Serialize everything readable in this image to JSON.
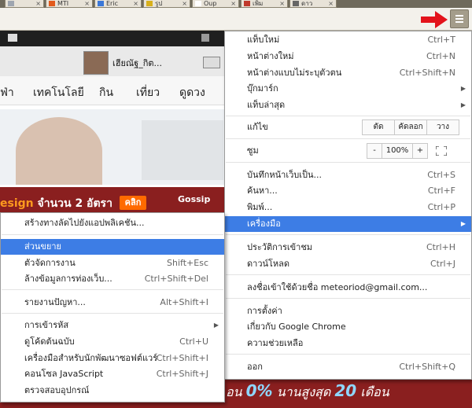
{
  "browser": {
    "tabs": [
      {
        "title": "MTI",
        "favicon_color": "#e25a1c"
      },
      {
        "title": "Eric",
        "favicon_color": "#3b78d8"
      },
      {
        "title": "รูป",
        "favicon_color": "#d8b01c"
      },
      {
        "title": "Oup",
        "favicon_color": "#ffffff"
      },
      {
        "title": "เพิ่ม",
        "favicon_color": "#c0392b"
      },
      {
        "title": "ดาว",
        "favicon_color": "#666666"
      }
    ],
    "tab_close": "×",
    "accent_color": "#3d7de5"
  },
  "page": {
    "username": "เฮียณัฐ_กิต...",
    "nav_items": [
      "ฟ่า",
      "เทคโนโลยี",
      "กิน",
      "เที่ยว",
      "ดูดวง"
    ],
    "promo_highlight": "esign",
    "promo_text": " จำนวน 2 อัตรา",
    "click_label": "คลิก",
    "gossip_label": "Gossip",
    "banner_pre": "อน ",
    "banner_pct": "0%",
    "banner_mid": " นานสูงสุด ",
    "banner_num": "20",
    "banner_post": " เดือน"
  },
  "menu": {
    "new_tab": {
      "label": "แท็บใหม่",
      "shortcut": "Ctrl+T"
    },
    "new_window": {
      "label": "หน้าต่างใหม่",
      "shortcut": "Ctrl+N"
    },
    "incognito": {
      "label": "หน้าต่างแบบไม่ระบุตัวตน",
      "shortcut": "Ctrl+Shift+N"
    },
    "bookmarks": {
      "label": "บุ๊กมาร์ก"
    },
    "recent_tabs": {
      "label": "แท็บล่าสุด"
    },
    "edit": {
      "label": "แก้ไข",
      "cut": "ตัด",
      "copy": "คัดลอก",
      "paste": "วาง"
    },
    "zoom": {
      "label": "ซูม",
      "minus": "-",
      "value": "100%",
      "plus": "+"
    },
    "save_page": {
      "label": "บันทึกหน้าเว็บเป็น...",
      "shortcut": "Ctrl+S"
    },
    "find": {
      "label": "ค้นหา...",
      "shortcut": "Ctrl+F"
    },
    "print": {
      "label": "พิมพ์...",
      "shortcut": "Ctrl+P"
    },
    "tools": {
      "label": "เครื่องมือ"
    },
    "history": {
      "label": "ประวัติการเข้าชม",
      "shortcut": "Ctrl+H"
    },
    "downloads": {
      "label": "ดาวน์โหลด",
      "shortcut": "Ctrl+J"
    },
    "signed_in": {
      "label": "ลงชื่อเข้าใช้ด้วยชื่อ meteoriod@gmail.com..."
    },
    "settings": {
      "label": "การตั้งค่า"
    },
    "about": {
      "label": "เกี่ยวกับ Google Chrome"
    },
    "help": {
      "label": "ความช่วยเหลือ"
    },
    "exit": {
      "label": "ออก",
      "shortcut": "Ctrl+Shift+Q"
    }
  },
  "submenu": {
    "create_shortcut": {
      "label": "สร้างทางลัดไปยังแอปพลิเคชัน..."
    },
    "extensions": {
      "label": "ส่วนขยาย"
    },
    "task_manager": {
      "label": "ตัวจัดการงาน",
      "shortcut": "Shift+Esc"
    },
    "clear_data": {
      "label": "ล้างข้อมูลการท่องเว็บ...",
      "shortcut": "Ctrl+Shift+Del"
    },
    "report_issue": {
      "label": "รายงานปัญหา...",
      "shortcut": "Alt+Shift+I"
    },
    "encoding": {
      "label": "การเข้ารหัส"
    },
    "view_source": {
      "label": "ดูโค้ดต้นฉบับ",
      "shortcut": "Ctrl+U"
    },
    "dev_tools": {
      "label": "เครื่องมือสำหรับนักพัฒนาซอฟต์แวร์",
      "shortcut": "Ctrl+Shift+I"
    },
    "js_console": {
      "label": "คอนโซล JavaScript",
      "shortcut": "Ctrl+Shift+J"
    },
    "inspect_devices": {
      "label": "ตรวจสอบอุปกรณ์"
    }
  }
}
